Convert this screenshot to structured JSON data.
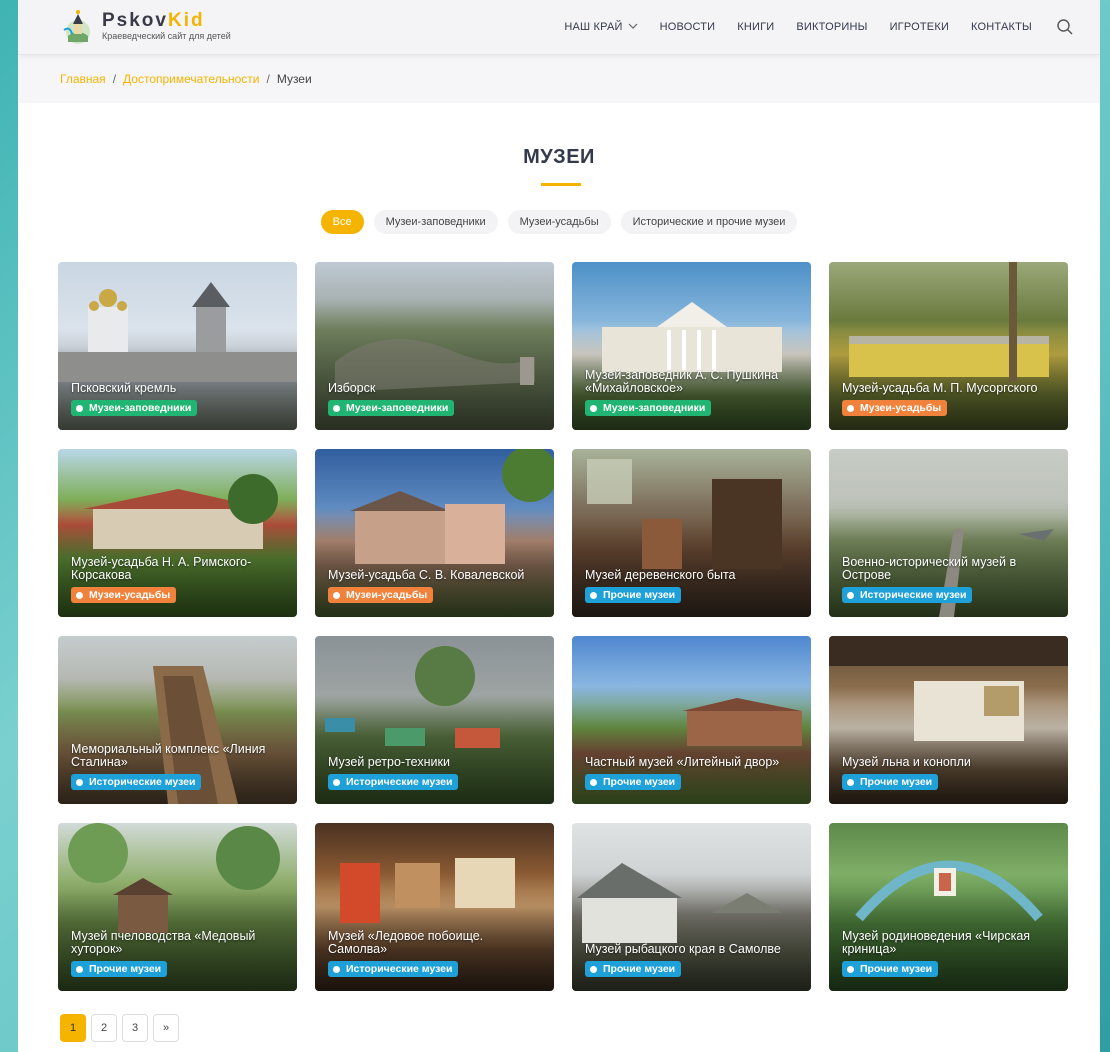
{
  "header": {
    "brand_main": "Pskov",
    "brand_accent": "Kid",
    "tagline": "Краеведческий сайт для детей",
    "nav": [
      {
        "label": "НАШ КРАЙ"
      },
      {
        "label": "НОВОСТИ"
      },
      {
        "label": "КНИГИ"
      },
      {
        "label": "ВИКТОРИНЫ"
      },
      {
        "label": "ИГРОТЕКИ"
      },
      {
        "label": "КОНТАКТЫ"
      }
    ],
    "search_icon": "search-icon"
  },
  "breadcrumb": {
    "items": [
      "Главная",
      "Достопримечательности"
    ],
    "separator": "/",
    "current": "Музеи"
  },
  "page": {
    "title": "МУЗЕИ"
  },
  "filters": [
    {
      "label": "Все",
      "active": true
    },
    {
      "label": "Музеи-заповедники",
      "active": false
    },
    {
      "label": "Музеи-усадьбы",
      "active": false
    },
    {
      "label": "Исторические и прочие музеи",
      "active": false
    }
  ],
  "colors": {
    "accent": "#f4b400",
    "badge_reserve": "#20b573",
    "badge_estate": "#f0823c",
    "badge_history": "#1ea0d8",
    "badge_other": "#1ea0d8"
  },
  "cards": [
    {
      "title": "Псковский кремль",
      "badge": "Музеи-заповедники",
      "badge_type": "reserve"
    },
    {
      "title": "Изборск",
      "badge": "Музеи-заповедники",
      "badge_type": "reserve"
    },
    {
      "title": "Музей-заповедник А. С. Пушкина «Михайловское»",
      "badge": "Музеи-заповедники",
      "badge_type": "reserve"
    },
    {
      "title": "Музей-усадьба М. П. Мусоргского",
      "badge": "Музеи-усадьбы",
      "badge_type": "estate"
    },
    {
      "title": "Музей-усадьба Н. А. Римского-Корсакова",
      "badge": "Музеи-усадьбы",
      "badge_type": "estate"
    },
    {
      "title": "Музей-усадьба С. В. Ковалевской",
      "badge": "Музеи-усадьбы",
      "badge_type": "estate"
    },
    {
      "title": "Музей деревенского быта",
      "badge": "Прочие музеи",
      "badge_type": "other"
    },
    {
      "title": "Военно-исторический музей в Острове",
      "badge": "Исторические музеи",
      "badge_type": "history"
    },
    {
      "title": "Мемориальный комплекс «Линия Сталина»",
      "badge": "Исторические музеи",
      "badge_type": "history"
    },
    {
      "title": "Музей ретро-техники",
      "badge": "Исторические музеи",
      "badge_type": "history"
    },
    {
      "title": "Частный музей «Литейный двор»",
      "badge": "Прочие музеи",
      "badge_type": "other"
    },
    {
      "title": "Музей льна и конопли",
      "badge": "Прочие музеи",
      "badge_type": "other"
    },
    {
      "title": "Музей пчеловодства «Медовый хуторок»",
      "badge": "Прочие музеи",
      "badge_type": "other"
    },
    {
      "title": "Музей «Ледовое побоище. Самолва»",
      "badge": "Исторические музеи",
      "badge_type": "history"
    },
    {
      "title": "Музей рыбацкого края в Самолве",
      "badge": "Прочие музеи",
      "badge_type": "other"
    },
    {
      "title": "Музей родиноведения «Чирская криница»",
      "badge": "Прочие музеи",
      "badge_type": "other"
    }
  ],
  "pagination": {
    "pages": [
      "1",
      "2",
      "3"
    ],
    "current": "1",
    "next": "»"
  }
}
